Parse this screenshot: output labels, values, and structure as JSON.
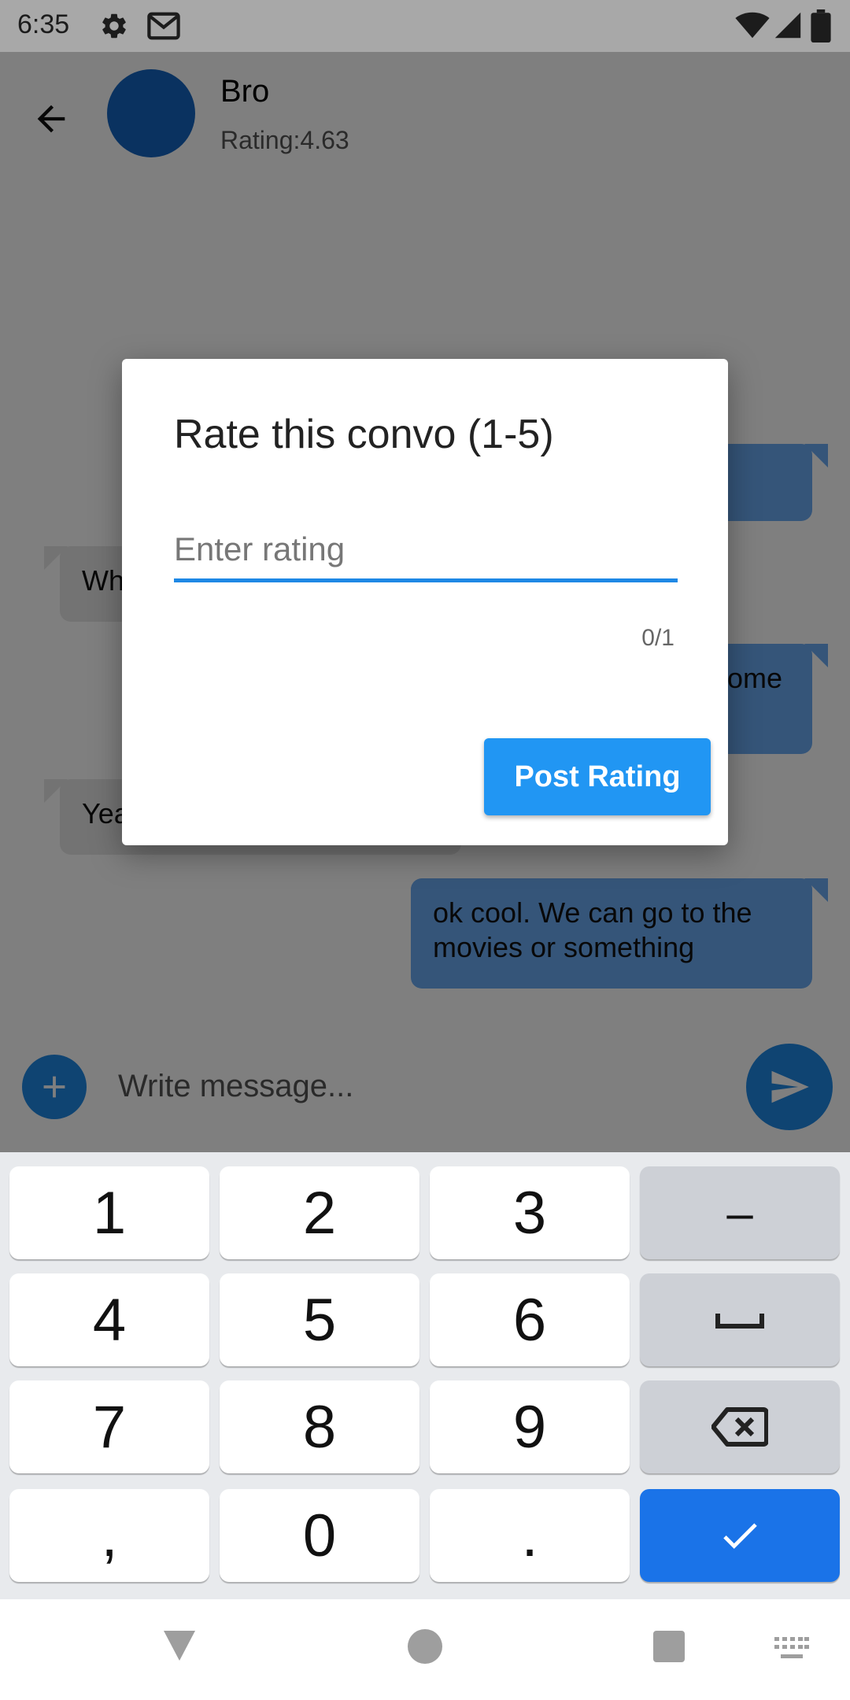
{
  "status_bar": {
    "time": "6:35"
  },
  "header": {
    "contact_name": "Bro",
    "contact_rating": "Rating:4.63"
  },
  "messages": [
    {
      "direction": "in",
      "text": "Wh"
    },
    {
      "direction": "out",
      "text": "ome"
    },
    {
      "direction": "in",
      "text": "Yea"
    },
    {
      "direction": "out",
      "text": "ok cool. We can go to the movies or something"
    }
  ],
  "composer": {
    "placeholder": "Write message..."
  },
  "dialog": {
    "title": "Rate this convo (1-5)",
    "input_placeholder": "Enter rating",
    "input_value": "",
    "counter": "0/1",
    "post_button": "Post Rating"
  },
  "keyboard": {
    "keys": [
      "1",
      "2",
      "3",
      "–",
      "4",
      "5",
      "6",
      "␣",
      "7",
      "8",
      "9",
      "⌫",
      ",",
      "0",
      ".",
      "✓"
    ]
  },
  "colors": {
    "accent": "#2196f3",
    "keyboard_enter": "#1a73e8",
    "avatar": "#1565c0"
  }
}
